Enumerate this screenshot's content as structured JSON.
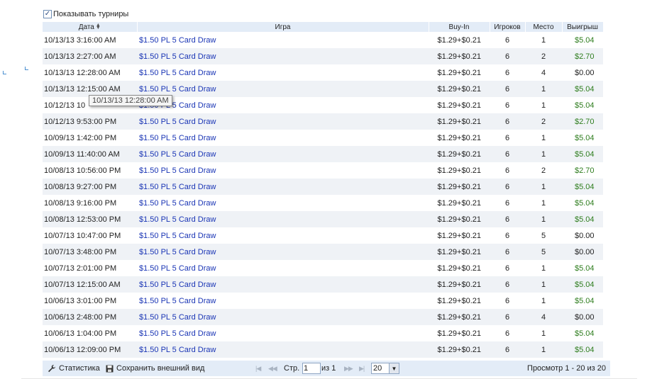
{
  "toolbar": {
    "show_tournaments_label": "Показывать турниры",
    "show_tournaments_checked": true
  },
  "table": {
    "columns": {
      "date": "Дата",
      "game": "Игра",
      "buyin": "Buy-In",
      "players": "Игроков",
      "place": "Место",
      "win": "Выигрыш"
    },
    "rows": [
      {
        "date": "10/13/13 3:16:00 AM",
        "game": "$1.50 PL 5 Card Draw",
        "buyin": "$1.29+$0.21",
        "players": "6",
        "place": "1",
        "win": "$5.04"
      },
      {
        "date": "10/13/13 2:27:00 AM",
        "game": "$1.50 PL 5 Card Draw",
        "buyin": "$1.29+$0.21",
        "players": "6",
        "place": "2",
        "win": "$2.70"
      },
      {
        "date": "10/13/13 12:28:00 AM",
        "game": "$1.50 PL 5 Card Draw",
        "buyin": "$1.29+$0.21",
        "players": "6",
        "place": "4",
        "win": "$0.00"
      },
      {
        "date": "10/13/13 12:15:00 AM",
        "game": "$1.50 PL 5 Card Draw",
        "buyin": "$1.29+$0.21",
        "players": "6",
        "place": "1",
        "win": "$5.04"
      },
      {
        "date": "10/12/13 10",
        "game": "$1.50 PL 5 Card Draw",
        "buyin": "$1.29+$0.21",
        "players": "6",
        "place": "1",
        "win": "$5.04"
      },
      {
        "date": "10/12/13 9:53:00 PM",
        "game": "$1.50 PL 5 Card Draw",
        "buyin": "$1.29+$0.21",
        "players": "6",
        "place": "2",
        "win": "$2.70"
      },
      {
        "date": "10/09/13 1:42:00 PM",
        "game": "$1.50 PL 5 Card Draw",
        "buyin": "$1.29+$0.21",
        "players": "6",
        "place": "1",
        "win": "$5.04"
      },
      {
        "date": "10/09/13 11:40:00 AM",
        "game": "$1.50 PL 5 Card Draw",
        "buyin": "$1.29+$0.21",
        "players": "6",
        "place": "1",
        "win": "$5.04"
      },
      {
        "date": "10/08/13 10:56:00 PM",
        "game": "$1.50 PL 5 Card Draw",
        "buyin": "$1.29+$0.21",
        "players": "6",
        "place": "2",
        "win": "$2.70"
      },
      {
        "date": "10/08/13 9:27:00 PM",
        "game": "$1.50 PL 5 Card Draw",
        "buyin": "$1.29+$0.21",
        "players": "6",
        "place": "1",
        "win": "$5.04"
      },
      {
        "date": "10/08/13 9:16:00 PM",
        "game": "$1.50 PL 5 Card Draw",
        "buyin": "$1.29+$0.21",
        "players": "6",
        "place": "1",
        "win": "$5.04"
      },
      {
        "date": "10/08/13 12:53:00 PM",
        "game": "$1.50 PL 5 Card Draw",
        "buyin": "$1.29+$0.21",
        "players": "6",
        "place": "1",
        "win": "$5.04"
      },
      {
        "date": "10/07/13 10:47:00 PM",
        "game": "$1.50 PL 5 Card Draw",
        "buyin": "$1.29+$0.21",
        "players": "6",
        "place": "5",
        "win": "$0.00"
      },
      {
        "date": "10/07/13 3:48:00 PM",
        "game": "$1.50 PL 5 Card Draw",
        "buyin": "$1.29+$0.21",
        "players": "6",
        "place": "5",
        "win": "$0.00"
      },
      {
        "date": "10/07/13 2:01:00 PM",
        "game": "$1.50 PL 5 Card Draw",
        "buyin": "$1.29+$0.21",
        "players": "6",
        "place": "1",
        "win": "$5.04"
      },
      {
        "date": "10/07/13 12:15:00 AM",
        "game": "$1.50 PL 5 Card Draw",
        "buyin": "$1.29+$0.21",
        "players": "6",
        "place": "1",
        "win": "$5.04"
      },
      {
        "date": "10/06/13 3:01:00 PM",
        "game": "$1.50 PL 5 Card Draw",
        "buyin": "$1.29+$0.21",
        "players": "6",
        "place": "1",
        "win": "$5.04"
      },
      {
        "date": "10/06/13 2:48:00 PM",
        "game": "$1.50 PL 5 Card Draw",
        "buyin": "$1.29+$0.21",
        "players": "6",
        "place": "4",
        "win": "$0.00"
      },
      {
        "date": "10/06/13 1:04:00 PM",
        "game": "$1.50 PL 5 Card Draw",
        "buyin": "$1.29+$0.21",
        "players": "6",
        "place": "1",
        "win": "$5.04"
      },
      {
        "date": "10/06/13 12:09:00 PM",
        "game": "$1.50 PL 5 Card Draw",
        "buyin": "$1.29+$0.21",
        "players": "6",
        "place": "1",
        "win": "$5.04"
      }
    ]
  },
  "tooltip": "10/13/13 12:28:00 AM",
  "pager": {
    "stats_label": "Статистика",
    "save_view_label": "Сохранить внешний вид",
    "page_label": "Стр.",
    "page_value": "1",
    "of_label": "из 1",
    "page_size": "20",
    "summary": "Просмотр 1 - 20 из 20"
  },
  "colors": {
    "win_positive": "#2e7d1e",
    "win_zero": "#222222",
    "link": "#1a35b5",
    "header_bg": "#e3ecf7",
    "alt_row": "#eff2f6"
  }
}
